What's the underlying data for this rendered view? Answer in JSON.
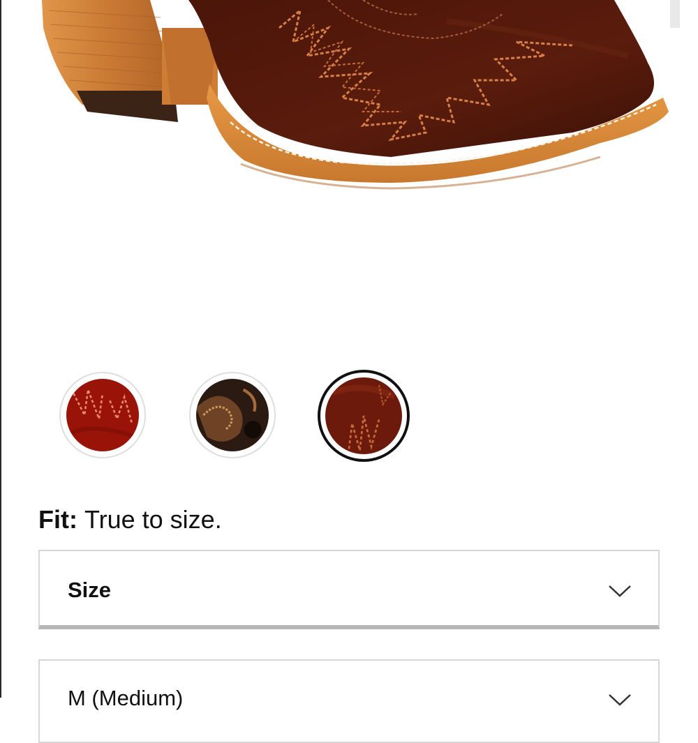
{
  "product_image": {
    "alt": "Brown western boot with orange stitched flame pattern",
    "icon": "product-photo"
  },
  "swatches": [
    {
      "name": "red-swatch",
      "color": "#9a1308",
      "stitch": "#e88a6a",
      "selected": false
    },
    {
      "name": "dark-pattern-swatch",
      "color": "#2a1a12",
      "stitch": "#a36a3a",
      "selected": false
    },
    {
      "name": "brown-swatch",
      "color": "#6b1a0c",
      "stitch": "#c9673e",
      "selected": true
    }
  ],
  "fit": {
    "label": "Fit:",
    "value": "True to size."
  },
  "size_select": {
    "label": "Size",
    "icon": "chevron-down-icon"
  },
  "width_select": {
    "value": "M (Medium)",
    "icon": "chevron-down-icon"
  }
}
